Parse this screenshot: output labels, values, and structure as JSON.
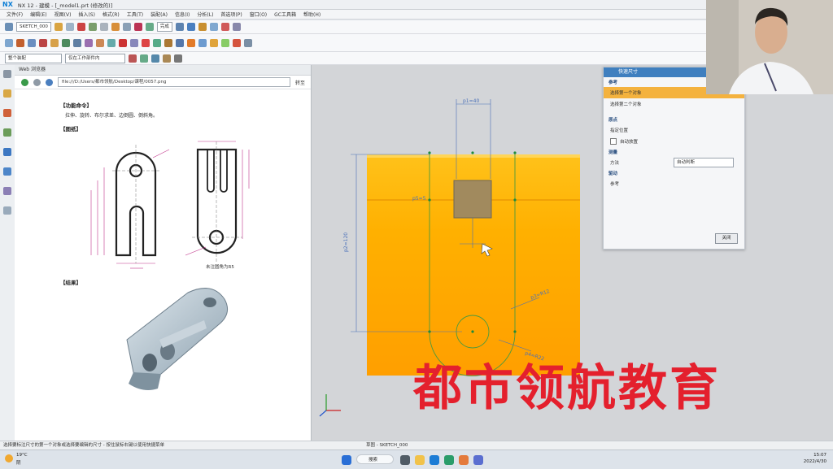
{
  "app": {
    "logo": "NX",
    "title": "NX 12 - 建模 - [_model1.prt (修改的)]"
  },
  "menu": [
    "文件(F)",
    "编辑(E)",
    "视图(V)",
    "插入(S)",
    "格式(R)",
    "工具(T)",
    "装配(A)",
    "信息(I)",
    "分析(L)",
    "首选项(P)",
    "窗口(O)",
    "GC工具箱",
    "帮助(H)"
  ],
  "toolbar": {
    "sketch_select": "SKETCH_000",
    "finish_label": "完成",
    "filter_select": "整个装配",
    "snap_select": "仅在工作部件内"
  },
  "browser": {
    "header": "Web 浏览器",
    "url": "file:///D:/Users/都市领航/Desktop/课程/0057.png",
    "go": "转至"
  },
  "document": {
    "section_task": "【功能命令】",
    "task_text": "拉伸、旋转、布尔求差、边倒圆、倒斜角。",
    "section_drawing": "【图纸】",
    "caption": "未注圆角为R5",
    "section_result": "【结果】"
  },
  "dialog": {
    "title": "快速尺寸",
    "section_ref": "参考",
    "row1": "选择第一个对象",
    "row2": "选择第二个对象",
    "section_origin": "原点",
    "origin_row": "指定位置",
    "auto_place": "自动放置",
    "section_measure": "测量",
    "method_label": "方法",
    "method_value": "自动判断",
    "section_driving": "驱动",
    "driving_row": "参考",
    "close": "关闭"
  },
  "sketch": {
    "dim_top": "p1=40",
    "dim_left": "p2=120",
    "dim_r1": "p3=R12",
    "dim_r2": "p4=R22",
    "dim_small": "p5=5"
  },
  "status": {
    "left": "选择要标注尺寸的第一个对象或选择要编辑的尺寸 - 按住鼠标右键以使用快捷菜单",
    "center": "草图 - SKETCH_000"
  },
  "taskbar": {
    "weather_temp": "19°C",
    "weather_text": "阴",
    "search": "搜索",
    "time": "15:07",
    "date": "2022/4/30"
  },
  "watermark": "都市领航教育",
  "colors": {
    "accent": "#3f7fbf",
    "block": "#ffa600",
    "watermark": "#e4202d",
    "active_row": "#f4b23e"
  }
}
